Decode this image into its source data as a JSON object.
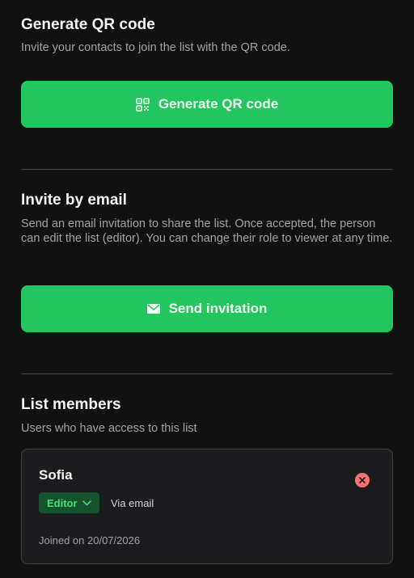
{
  "qr_section": {
    "title": "Generate QR code",
    "description": "Invite your contacts to join the list with the QR code.",
    "button_label": "Generate QR code"
  },
  "email_section": {
    "title": "Invite by email",
    "description": "Send an email invitation to share the list. Once accepted, the person can edit the list (editor). You can change their role to viewer at any time.",
    "button_label": "Send invitation"
  },
  "members_section": {
    "title": "List members",
    "description": "Users who have access to this list",
    "members": [
      {
        "name": "Sofia",
        "role": "Editor",
        "via": "Via email",
        "joined": "Joined on 20/07/2026"
      }
    ]
  },
  "colors": {
    "background": "#111111",
    "accent_green": "#22c55e",
    "role_badge_bg": "#14532d",
    "role_badge_text": "#4ade80",
    "remove_red": "#f87171"
  },
  "icons": {
    "qr_button": "qr-code-icon",
    "email_button": "envelope-icon",
    "role_dropdown": "chevron-down-icon",
    "remove_member": "close-circle-icon"
  }
}
